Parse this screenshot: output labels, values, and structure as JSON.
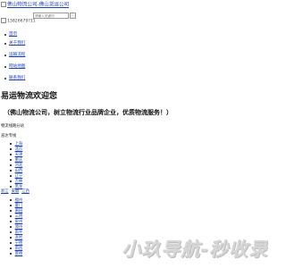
{
  "header": {
    "logo_alt": "佛山物流公司-佛山货运公司",
    "search_placeholder": "请输入关键词",
    "hotline_alt": "13826679?11"
  },
  "nav": {
    "items": [
      {
        "label": "首页"
      },
      {
        "label": "关于我们"
      },
      {
        "label": "运输流程"
      },
      {
        "label": "网站地图"
      },
      {
        "label": "联系我们"
      }
    ]
  },
  "main": {
    "headline": "易运物流欢迎您",
    "subline": "（佛山物流公司，树立物流行业品牌企业，优质物流服务！）",
    "network_title": "物流线路分站",
    "direct_label": "直达专线",
    "direct_list": [
      "上海",
      "北京",
      "天津",
      "重庆",
      "河北",
      "山西",
      "辽宁",
      "吉林",
      "黑龙"
    ],
    "province_row": [
      "浙江",
      "安徽",
      "江西"
    ],
    "city_list": [
      "福州",
      "厦门",
      "莆田",
      "三明",
      "泉州",
      "漳州",
      "南平",
      "龙岩",
      "宁德",
      "南昌",
      "景德"
    ]
  },
  "watermark": {
    "text": "小玖导航-秒收录"
  }
}
